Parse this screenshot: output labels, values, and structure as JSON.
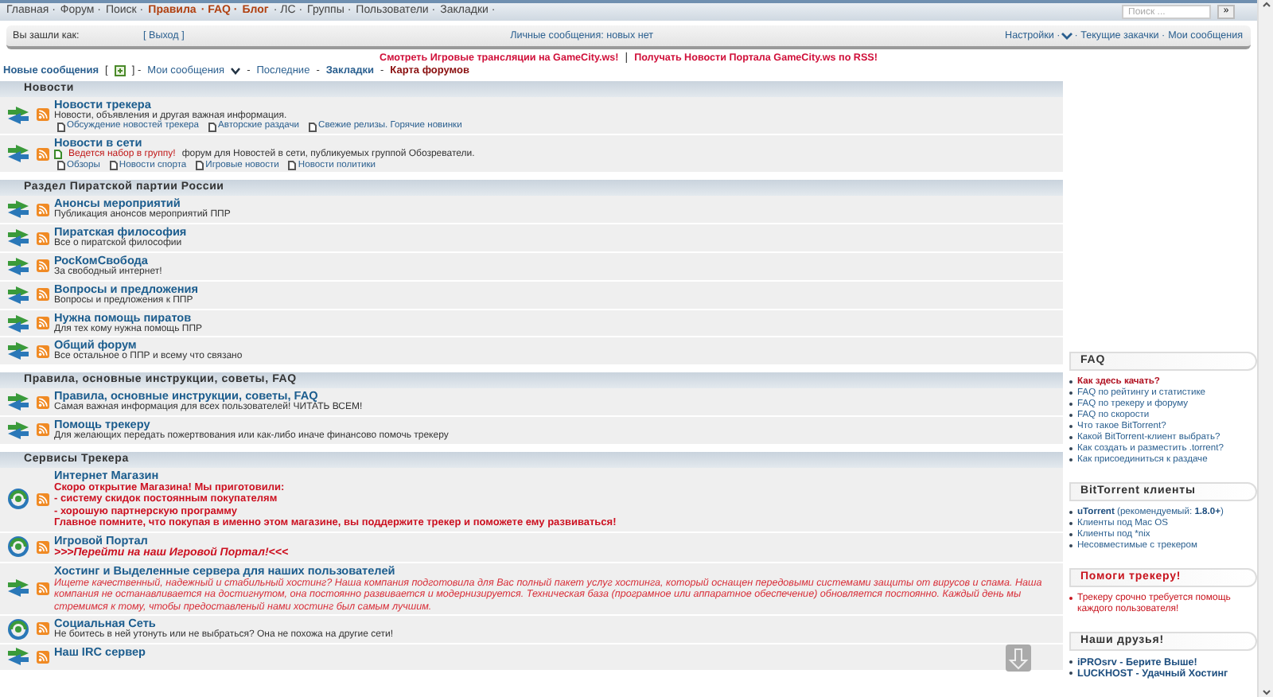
{
  "nav": {
    "items": [
      {
        "label": "Главная ·",
        "kind": "plain"
      },
      {
        "label": "Форум ·",
        "kind": "plain"
      },
      {
        "label": "Поиск ·",
        "kind": "plain"
      },
      {
        "label": "Правила",
        "kind": "accent"
      },
      {
        "label": "· FAQ ·",
        "kind": "accent"
      },
      {
        "label": "Блог",
        "kind": "accent"
      },
      {
        "label": "· ЛС ·",
        "kind": "plain"
      },
      {
        "label": "Группы ·",
        "kind": "plain"
      },
      {
        "label": "Пользователи ·",
        "kind": "plain"
      },
      {
        "label": "Закладки ·",
        "kind": "plain"
      }
    ],
    "search": {
      "placeholder": "Поиск ...",
      "button": "»"
    }
  },
  "login_bar": {
    "label": "Вы зашли как:",
    "logout": "[ Выход ]",
    "messages": "Личные сообщения: новых нет",
    "links": [
      "Настройки ·",
      "· Текущие закачки ·",
      "Мои сообщения"
    ]
  },
  "announcements": {
    "items": [
      "Смотреть Игровые трансляции на GameCity.ws!",
      "Получать Новости Портала GameCity.ws по RSS!"
    ],
    "separator": "|"
  },
  "quick_links": [
    {
      "kind": "bold",
      "label": "Новые сообщения"
    },
    {
      "kind": "sep",
      "label": "["
    },
    {
      "kind": "icon"
    },
    {
      "kind": "sep",
      "label": "] -"
    },
    {
      "kind": "plain",
      "label": "Мои сообщения"
    },
    {
      "kind": "caret"
    },
    {
      "kind": "sep",
      "label": "-"
    },
    {
      "kind": "plain",
      "label": "Последние"
    },
    {
      "kind": "sep",
      "label": "-"
    },
    {
      "kind": "bold",
      "label": "Закладки"
    },
    {
      "kind": "sep",
      "label": "-"
    },
    {
      "kind": "accent",
      "label": "Карта форумов"
    }
  ],
  "categories": [
    {
      "title": "Новости",
      "forums": [
        {
          "kind": "plain",
          "title": "Новости трекера",
          "description": [
            "Новости, объявления и другая важная информация."
          ],
          "subforums": [
            "Обсуждение новостей трекера",
            "Авторские раздачи",
            "Свежие релизы. Горячие новинки"
          ]
        },
        {
          "kind": "plain",
          "title": "Новости в сети",
          "notice": "Ведется набор в группу!",
          "description": [
            "форум для Новостей в сети, публикуемых группой Обозреватели."
          ],
          "subforums": [
            "Обзоры",
            "Новости спорта",
            "Игровые новости",
            "Новости политики"
          ]
        }
      ]
    },
    {
      "title": "Раздел Пиратской партии России",
      "forums": [
        {
          "kind": "plain",
          "title": "Анонсы мероприятий",
          "description": [
            "Публикация анонсов мероприятий ППР"
          ]
        },
        {
          "kind": "plain",
          "title": "Пиратская философия",
          "description": [
            "Все о пиратской философии"
          ]
        },
        {
          "kind": "plain",
          "title": "РосКомСвобода",
          "description": [
            "За свободный интернет!"
          ]
        },
        {
          "kind": "plain",
          "title": "Вопросы и предложения",
          "description": [
            "Вопросы и предложения к ППР"
          ]
        },
        {
          "kind": "plain",
          "title": "Нужна помощь пиратов",
          "description": [
            "Для тех кому нужна помощь ППР"
          ]
        },
        {
          "kind": "plain",
          "title": "Общий форум",
          "description": [
            "Все остальное о ППР и всему что связано"
          ]
        }
      ]
    },
    {
      "title": "Правила, основные инструкции, советы, FAQ",
      "forums": [
        {
          "kind": "plain",
          "title": "Правила, основные инструкции, советы, FAQ",
          "description": [
            "Самая важная информация для всех пользователей! ЧИТАТЬ ВСЕМ!"
          ]
        },
        {
          "kind": "plain",
          "title": "Помощь трекеру",
          "description": [
            "Для желающих передать пожертвования или как-либо иначе финансово помочь трекеру"
          ]
        }
      ]
    },
    {
      "title": "Сервисы Трекера",
      "forums": [
        {
          "kind": "shop",
          "title": "Интернет Магазин",
          "description": [
            "Скоро открытие Магазина! Мы приготовили:",
            "- систему скидок постоянным покупателям",
            "- хорошую партнерскую программу",
            "Главное помните, что покупая в именно этом магазине, вы поддержите трекер и поможете ему развиваться!"
          ]
        },
        {
          "kind": "portal",
          "title": "Игровой Портал",
          "description": [
            ">>>Перейти на наш Игровой Портал!<<<"
          ]
        },
        {
          "kind": "hosting",
          "title": "Хостинг и Выделенные сервера для наших пользователей",
          "description": [
            "Ищете качественный, надежный и стабильный хостинг? Наша компания подготовила для Вас полный пакет услуг хостинга, который оснащен передовыми системами защиты от вирусов и спама. Наша компания не останавливается на достигнутом, она постоянно развивается и модернизируется. Техническая база (програмное или аппаратное обеспечение) обновляется постоянно. Каждый день мы стремимся к тому, чтобы предоставленый нами хостинг был самым лучшим."
          ]
        },
        {
          "kind": "social",
          "title": "Социальная Сеть",
          "description": [
            "Не боитесь в ней утонуть или не выбраться? Она не похожа на другие сети!"
          ]
        },
        {
          "kind": "plain",
          "title": "Наш IRC сервер"
        }
      ]
    }
  ],
  "sidebar": [
    {
      "title": "FAQ",
      "kind": "normal",
      "items": [
        {
          "text": "Как здесь качать?",
          "kind": "accent"
        },
        {
          "text": "FAQ по рейтингу и статистике",
          "kind": "link"
        },
        {
          "text": "FAQ по трекеру и форуму",
          "kind": "link"
        },
        {
          "text": "FAQ по скорости",
          "kind": "link"
        },
        {
          "text": "Что такое BitTorrent?",
          "kind": "link"
        },
        {
          "text": "Какой BitTorrent-клиент выбрать?",
          "kind": "link"
        },
        {
          "text": "Как создать и разместить .torrent?",
          "kind": "link"
        },
        {
          "text": "Как присоединиться к раздаче",
          "kind": "link"
        }
      ]
    },
    {
      "title": "BitTorrent клиенты",
      "kind": "normal",
      "items": [
        {
          "text": "**uTorrent** (рекомендуемый: **1.8.0+**)",
          "kind": "rich"
        },
        {
          "text": "Клиенты под Mac OS",
          "kind": "link"
        },
        {
          "text": "Клиенты под *nix",
          "kind": "link"
        },
        {
          "text": "Несовместимые с трекером",
          "kind": "link"
        }
      ]
    },
    {
      "title": "Помоги трекеру!",
      "kind": "alert",
      "items": [
        {
          "text": "Трекеру срочно требуется помощь каждого пользователя!",
          "kind": "alert"
        }
      ]
    },
    {
      "title": "Наши друзья!",
      "kind": "normal",
      "items": [
        {
          "text": "iPROsrv - Берите Выше!",
          "kind": "strong"
        },
        {
          "text": "LUCKHOST - Удачный Хостинг",
          "kind": "strong"
        }
      ]
    }
  ]
}
